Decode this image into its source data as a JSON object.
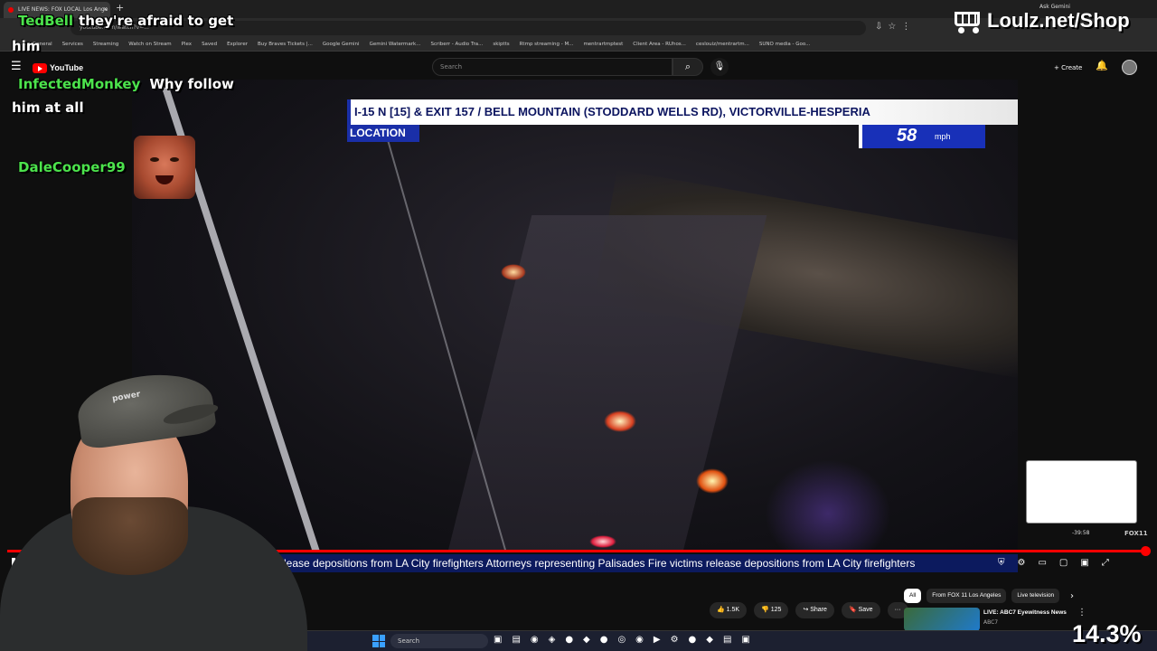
{
  "browser": {
    "tab_title": "LIVE NEWS: FOX LOCAL Los Ange",
    "new_tab": "+",
    "address": "youtube.com/watch?v=...",
    "ask_gemini": "Ask Gemini",
    "bookmarks": [
      "General",
      "Services",
      "Streaming",
      "Watch on Stream",
      "Plex",
      "Saved",
      "Explorer",
      "Buy Braves Tickets |...",
      "Google Gemini",
      "Gemini Watermark...",
      "Scriberr - Audio Tra...",
      "skiptts",
      "Rtmp streaming - M...",
      "mentrartmptest",
      "Client Area - RUhos...",
      "ceslouiz/mentrartm...",
      "SUNO media - Goo..."
    ]
  },
  "youtube": {
    "logo": "YouTube",
    "search_placeholder": "Search",
    "create": "+ Create"
  },
  "video": {
    "location_bar": "I-15 N [15] & EXIT 157 / BELL MOUNTAIN (STODDARD WELLS RD), VICTORVILLE-HESPERIA",
    "location_tag": "LOCATION",
    "speed_value": "58",
    "speed_unit": "mph",
    "ticker": "s release depositions from LA City firefighters  Attorneys representing Palisades Fire victims release depositions from LA City firefighters",
    "preview_time": "-39:58",
    "preview_channel": "FOX11",
    "progress": 1.0
  },
  "actions": {
    "likes": "1.5K",
    "dislikes": "125",
    "share": "Share",
    "save": "Save",
    "more": "···"
  },
  "related": {
    "chips": [
      "All",
      "From FOX 11 Los Angeles",
      "Live television"
    ],
    "rec_title": "LIVE: ABC7 Eyewitness News",
    "rec_channel": "ABC7"
  },
  "taskbar": {
    "search": "Search"
  },
  "overlay": {
    "chat": [
      {
        "user": "TedBell",
        "msg": "they're afraid to get",
        "cont": "him"
      },
      {
        "user": "InfectedMonkey",
        "msg": "Why follow",
        "cont": "him at all"
      },
      {
        "user": "DaleCooper99",
        "msg": ""
      }
    ],
    "shop": "Loulz.net/Shop",
    "cap_logo": "power",
    "zoom": "14.3%"
  }
}
